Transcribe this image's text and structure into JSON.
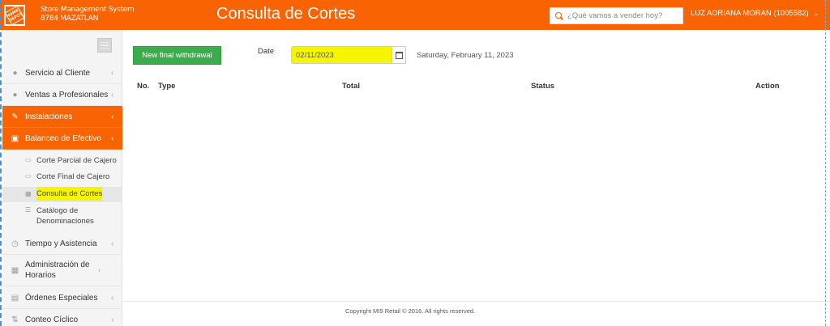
{
  "header": {
    "logo_text": "HOME DEPOT",
    "system_name": "Store Management System",
    "store": "8784 MAZATLAN",
    "title": "Consulta de Cortes",
    "search_placeholder": "¿Qué vamos a vender hoy?",
    "user": "LUZ ADRIANA MORAN (1005582)",
    "user_chevron": "⌄"
  },
  "sidebar": {
    "items": [
      {
        "label": "Servicio al Cliente",
        "icon": "user-icon",
        "glyph": "👤"
      },
      {
        "label": "Ventas a Profesionales",
        "icon": "user-icon",
        "glyph": "👤"
      },
      {
        "label": "Instalaciones",
        "icon": "wrench-icon",
        "glyph": "🔧"
      },
      {
        "label": "Balanceo de Efectivo",
        "icon": "cash-icon",
        "glyph": "▣"
      },
      {
        "label": "Tiempo y Asistencia",
        "icon": "clock-icon",
        "glyph": "◷"
      },
      {
        "label": "Administración de Horarios",
        "icon": "calendar-icon",
        "glyph": "▦"
      },
      {
        "label": "Órdenes Especiales",
        "icon": "file-icon",
        "glyph": "▤"
      },
      {
        "label": "Conteo Cíclico",
        "icon": "sort-icon",
        "glyph": "⇅"
      }
    ],
    "subitems": [
      {
        "label": "Corte Parcial de Cajero",
        "icon": "cash-icon",
        "glyph": "▭"
      },
      {
        "label": "Corte Final de Cajero",
        "icon": "cash-icon",
        "glyph": "▭"
      },
      {
        "label": "Consulta de Cortes",
        "icon": "calendar-icon",
        "glyph": "▦"
      },
      {
        "label": "Catálogo de Denominaciones",
        "icon": "list-icon",
        "glyph": "☰"
      }
    ],
    "chevron": "‹"
  },
  "main": {
    "new_withdrawal_label": "New final withdrawal",
    "date_label": "Date",
    "date_value": "02/11/2023",
    "date_long": "Saturday, February 11, 2023",
    "table_headers": [
      "No.",
      "Type",
      "Total",
      "Status",
      "Action"
    ]
  },
  "footer": {
    "copyright": "Copyright MI9 Retail © 2016. All rights reserved."
  },
  "colors": {
    "brand": "#f96302",
    "button_green": "#3bac4b",
    "highlight": "#f5f500"
  }
}
